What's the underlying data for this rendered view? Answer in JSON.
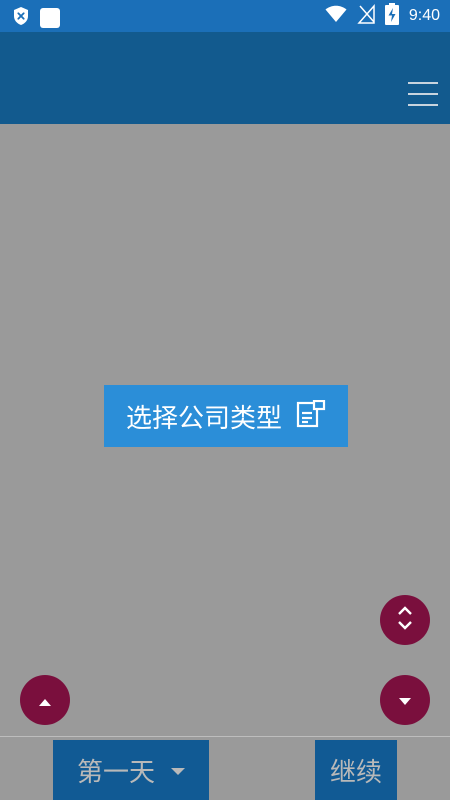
{
  "status_bar": {
    "time": "9:40"
  },
  "main": {
    "select_company_type_label": "选择公司类型"
  },
  "bottom_bar": {
    "day_selector_label": "第一天",
    "continue_label": "继续"
  },
  "colors": {
    "status_bar": "#1b6fb8",
    "app_bar": "#125a8e",
    "overlay": "#9a9a9a",
    "primary_button": "#2b8ed8",
    "fab": "#7a0f3d",
    "bottom_button": "#115a94"
  },
  "icons": [
    "shield-x-icon",
    "wifi-icon",
    "no-signal-icon",
    "battery-charging-icon",
    "menu-icon",
    "form-icon",
    "expand-icon",
    "arrow-up-icon",
    "arrow-down-icon",
    "dropdown-arrow-icon"
  ]
}
